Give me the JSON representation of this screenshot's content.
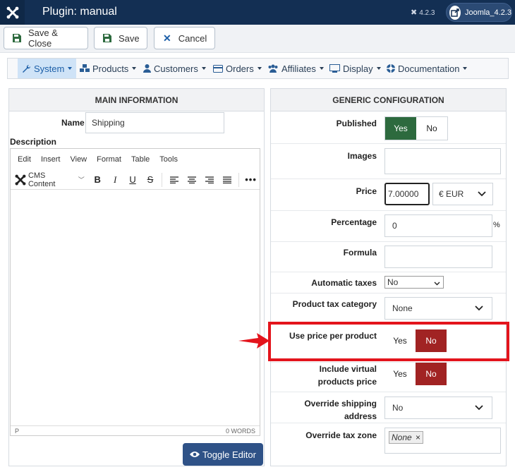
{
  "header": {
    "title": "Plugin: manual",
    "version": "4.2.3",
    "site_label": "Joomla_4.2.3"
  },
  "toolbar": {
    "save_close": "Save & Close",
    "save": "Save",
    "cancel": "Cancel"
  },
  "menu": {
    "items": [
      {
        "label": "System",
        "icon": "wrench-icon",
        "active": true
      },
      {
        "label": "Products",
        "icon": "cubes-icon"
      },
      {
        "label": "Customers",
        "icon": "user-icon"
      },
      {
        "label": "Orders",
        "icon": "credit-card-icon"
      },
      {
        "label": "Affiliates",
        "icon": "users-icon"
      },
      {
        "label": "Display",
        "icon": "desktop-icon"
      },
      {
        "label": "Documentation",
        "icon": "help-icon"
      }
    ]
  },
  "main": {
    "heading": "MAIN INFORMATION",
    "name_label": "Name",
    "name_value": "Shipping",
    "description_label": "Description",
    "editor": {
      "menu": [
        "Edit",
        "Insert",
        "View",
        "Format",
        "Table",
        "Tools"
      ],
      "cms_content": "CMS Content",
      "status_left": "P",
      "status_right": "0 WORDS"
    },
    "toggle_editor": "Toggle Editor"
  },
  "config": {
    "heading": "GENERIC CONFIGURATION",
    "published_label": "Published",
    "yes": "Yes",
    "no": "No",
    "images_label": "Images",
    "price_label": "Price",
    "price_value": "7.00000",
    "currency": "€ EUR",
    "percentage_label": "Percentage",
    "percentage_value": "0",
    "percent_sign": "%",
    "formula_label": "Formula",
    "auto_taxes_label": "Automatic taxes",
    "auto_taxes_value": "No",
    "product_tax_label": "Product tax category",
    "product_tax_value": "None",
    "use_price_label": "Use price per product",
    "include_virtual_label_1": "Include virtual",
    "include_virtual_label_2": "products price",
    "override_shipping_label": "Override shipping address",
    "override_shipping_value": "No",
    "override_tax_label": "Override tax zone",
    "override_tax_tag": "None",
    "tag_remove": "×"
  },
  "colors": {
    "header_bg": "#132f53",
    "yes_active": "#2d6a3e",
    "no_active": "#a12323",
    "highlight": "#e3141c",
    "toggle_btn": "#2f5287"
  }
}
